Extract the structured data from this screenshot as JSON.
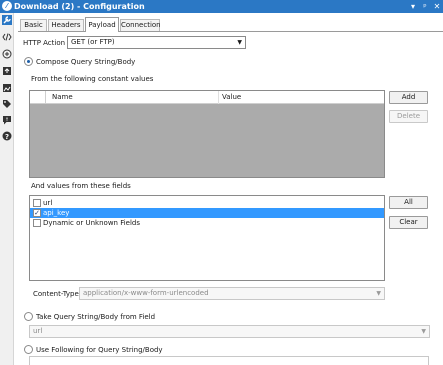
{
  "window": {
    "title": "Download (2) - Configuration",
    "title_icon": "alteryx-logo-icon",
    "controls": {
      "pin": "▾",
      "float": "ᵖ",
      "close": "✕"
    }
  },
  "toolrail": {
    "icons": [
      "wrench-icon",
      "code-icon",
      "workflow-icon",
      "arrow-up-icon",
      "image-icon",
      "tag-icon",
      "comment-icon",
      "help-icon"
    ],
    "active": "wrench-icon"
  },
  "tabs": [
    {
      "label": "Basic",
      "active": false
    },
    {
      "label": "Headers",
      "active": false
    },
    {
      "label": "Payload",
      "active": true
    },
    {
      "label": "Connection",
      "active": false
    }
  ],
  "http_action": {
    "label": "HTTP Action",
    "value": "GET (or FTP)"
  },
  "compose": {
    "radio_label": "Compose Query String/Body",
    "selected": true,
    "constant_label": "From the following constant values",
    "grid_columns": [
      "Name",
      "Value"
    ],
    "buttons": {
      "add": "Add",
      "delete": "Delete"
    }
  },
  "fields": {
    "label": "And values from these fields",
    "items": [
      {
        "label": "url",
        "checked": false,
        "selected": false
      },
      {
        "label": "api_key",
        "checked": true,
        "selected": true
      },
      {
        "label": "Dynamic or Unknown Fields",
        "checked": false,
        "selected": false
      }
    ],
    "buttons": {
      "all": "All",
      "clear": "Clear"
    }
  },
  "content_type": {
    "label": "Content-Type",
    "value": "application/x-www-form-urlencoded"
  },
  "take_query": {
    "radio_label": "Take Query String/Body from Field",
    "selected": false,
    "field_value": "url"
  },
  "use_following": {
    "radio_label": "Use Following for Query String/Body",
    "selected": false
  },
  "colors": {
    "titlebar": "#2b78c5",
    "selection": "#3399ff",
    "grid_fill": "#ababab"
  }
}
